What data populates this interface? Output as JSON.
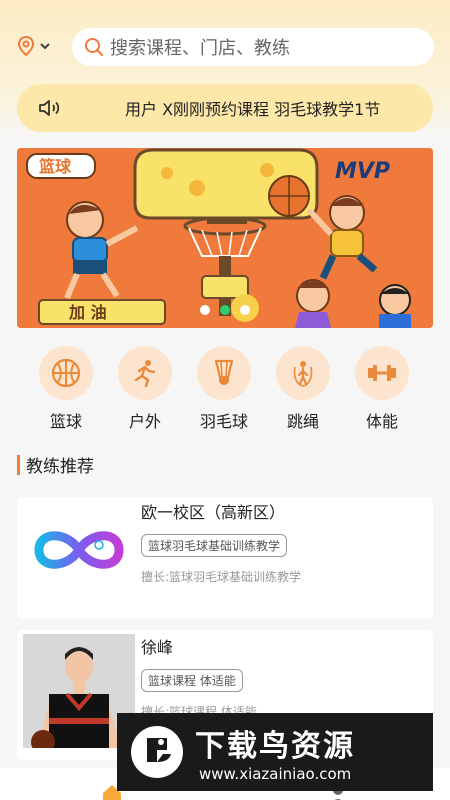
{
  "header": {
    "location_icon": "location-pin-icon",
    "search_placeholder": "搜索课程、门店、教练"
  },
  "notice": {
    "icon": "speaker-icon",
    "text": "用户 X刚刚预约课程 羽毛球教学1节"
  },
  "banner": {
    "badge_text": "篮球",
    "mvp_text": "MVP",
    "cheer_text": "加 油",
    "dots_count": 3,
    "active_dot": 1
  },
  "categories": [
    {
      "label": "篮球",
      "icon": "basketball-icon"
    },
    {
      "label": "户外",
      "icon": "running-icon"
    },
    {
      "label": "羽毛球",
      "icon": "shuttlecock-icon"
    },
    {
      "label": "跳绳",
      "icon": "jump-rope-icon"
    },
    {
      "label": "体能",
      "icon": "dumbbell-icon"
    }
  ],
  "section_title": "教练推荐",
  "coaches": [
    {
      "name": "欧一校区（高新区）",
      "tag": "篮球羽毛球基础训练教学",
      "skill": "擅长:篮球羽毛球基础训练教学",
      "avatar": "infinity-logo-icon"
    },
    {
      "name": "徐峰",
      "tag": "篮球课程 体适能",
      "skill": "擅长:篮球课程 体适能",
      "avatar": "coach-photo"
    }
  ],
  "watermark": {
    "title": "下载鸟资源",
    "url": "www.xiazainiao.com"
  },
  "colors": {
    "accent": "#f07a3c",
    "notice_bg": "#fde7a9",
    "category_bg": "#fde4cf"
  }
}
